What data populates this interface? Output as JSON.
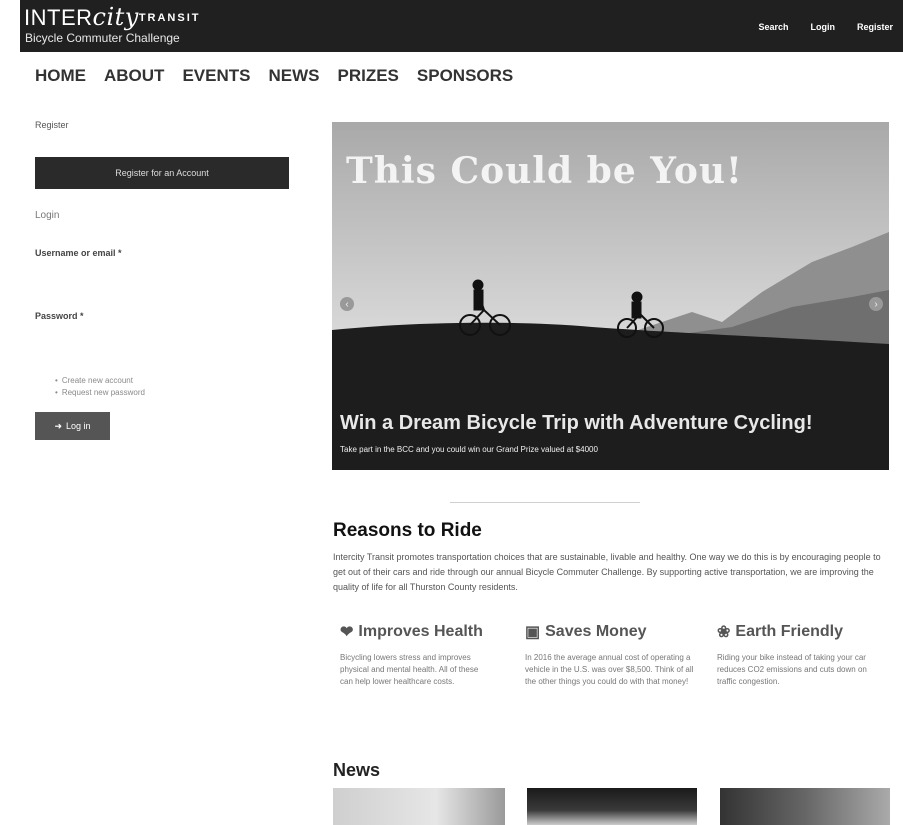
{
  "header": {
    "brand_prefix": "INTER",
    "brand_city": "city",
    "brand_transit": "TRANSIT",
    "subtitle": "Bicycle Commuter Challenge",
    "links": [
      "Search",
      "Login",
      "Register"
    ]
  },
  "nav": [
    "HOME",
    "ABOUT",
    "EVENTS",
    "NEWS",
    "PRIZES",
    "SPONSORS"
  ],
  "sidebar": {
    "register_label": "Register",
    "register_button": "Register for an Account",
    "login_title": "Login",
    "username_label": "Username or email *",
    "password_label": "Password *",
    "links": [
      "Create new account",
      "Request new password"
    ],
    "login_button": "Log in"
  },
  "slider": {
    "headline": "This Could be You!",
    "caption_title": "Win a Dream Bicycle Trip with Adventure Cycling!",
    "caption_sub": "Take part in the BCC and you could win our Grand Prize valued at $4000",
    "prev": "‹",
    "next": "›"
  },
  "reasons": {
    "title": "Reasons to Ride",
    "text": "Intercity Transit promotes transportation choices that are sustainable, livable and healthy. One way we do this is by encouraging people to get out of their cars and ride through our annual Bicycle Commuter Challenge. By supporting active transportation, we are improving the quality of life for all Thurston County residents.",
    "items": [
      {
        "icon": "heartbeat-icon",
        "title": "Improves Health",
        "text": "Bicycling lowers stress and improves physical and mental health. All of these can help lower healthcare costs."
      },
      {
        "icon": "money-icon",
        "title": "Saves Money",
        "text": "In 2016 the average annual cost of operating a vehicle in the U.S. was over $8,500. Think of all the other things you could do with that money!"
      },
      {
        "icon": "leaf-icon",
        "title": "Earth Friendly",
        "text": "Riding your bike instead of taking your car reduces CO2 emissions and cuts down on traffic congestion."
      }
    ]
  },
  "news": {
    "title": "News"
  },
  "colors": {
    "topbar": "#202020",
    "button_dark": "#2a2a2a",
    "login_button": "#555555"
  }
}
